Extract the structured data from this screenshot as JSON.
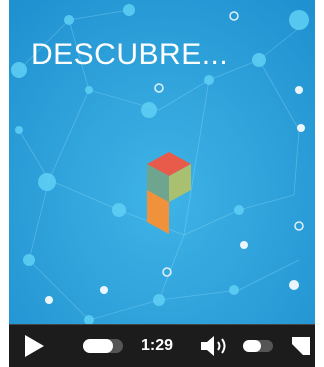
{
  "video": {
    "title_text": "DESCUBRE..."
  },
  "controls": {
    "play_icon": "play-icon",
    "time": "1:29",
    "progress_fraction": 0.75,
    "volume_icon": "speaker-volume-icon",
    "volume_level": 0.6,
    "fullscreen_icon": "fullscreen-icon"
  },
  "colors": {
    "background": "#2aa3d8",
    "nodes": "#5fd0f5",
    "controls_bar": "#1c1c1c"
  }
}
